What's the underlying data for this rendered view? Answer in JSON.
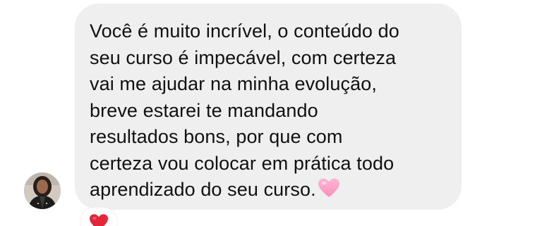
{
  "message": {
    "lines": [
      "Você é muito incrível, o conteúdo do",
      "seu curso é impecável, com certeza",
      "vai me ajudar na minha evolução,",
      "breve estarei te mandando",
      "resultados bons, por que com",
      "certeza vou colocar em prática todo",
      "aprendizado do seu curso."
    ],
    "trailing_emoji": "pink-heart-icon"
  },
  "sender": {
    "avatar_icon": "profile-photo"
  },
  "reaction": {
    "emoji": "red-heart-icon"
  },
  "colors": {
    "bubble": "#efefef",
    "text": "#111111",
    "pink_heart": "#ff9fc6",
    "red_heart": "#e3263a"
  }
}
